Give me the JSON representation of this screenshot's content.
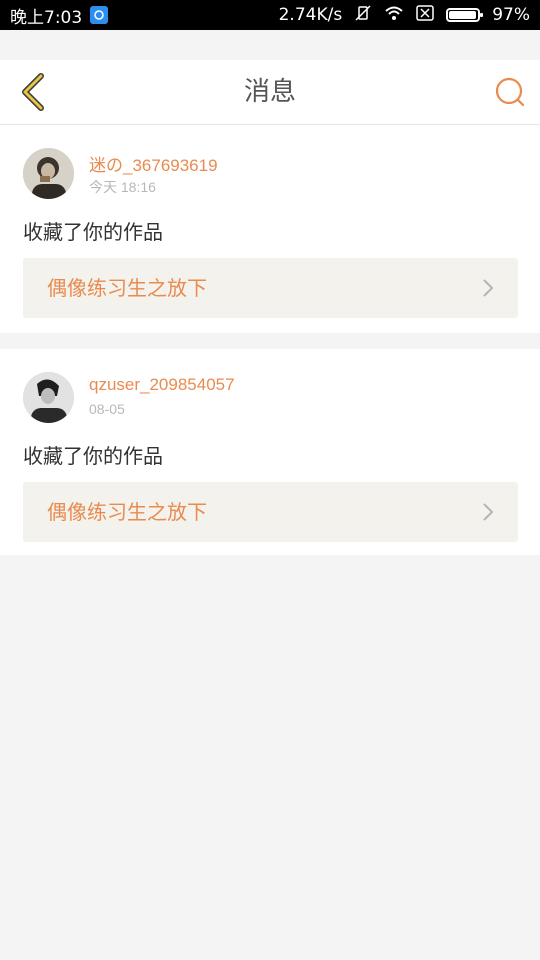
{
  "status_bar": {
    "time": "晚上7:03",
    "net_speed": "2.74K/s",
    "battery": "97%",
    "battery_level": 0.97
  },
  "nav": {
    "title": "消息",
    "back_icon": "back-arrow-icon",
    "search_icon": "search-icon"
  },
  "messages": [
    {
      "username": "迷の_367693619",
      "time": "今天 18:16",
      "action": "收藏了你的作品",
      "work_title": "偶像练习生之放下"
    },
    {
      "username": "qzuser_209854057",
      "time": "08-05",
      "action": "收藏了你的作品",
      "work_title": "偶像练习生之放下"
    }
  ],
  "colors": {
    "accent": "#e98b4f",
    "back_arrow": "#e8c542",
    "card_bg": "#ffffff",
    "page_bg": "#f4f4f4",
    "link_bg": "#f3f2ec"
  }
}
